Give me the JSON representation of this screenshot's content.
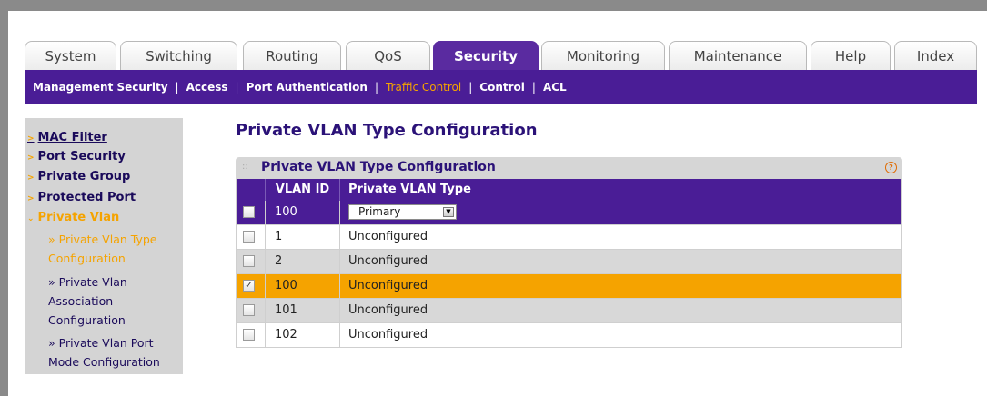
{
  "nav": {
    "tabs": [
      {
        "label": "System"
      },
      {
        "label": "Switching"
      },
      {
        "label": "Routing"
      },
      {
        "label": "QoS"
      },
      {
        "label": "Security",
        "active": true
      },
      {
        "label": "Monitoring"
      },
      {
        "label": "Maintenance"
      },
      {
        "label": "Help"
      },
      {
        "label": "Index"
      }
    ],
    "subnav": [
      {
        "label": "Management Security"
      },
      {
        "label": "Access"
      },
      {
        "label": "Port Authentication"
      },
      {
        "label": "Traffic Control",
        "active": true
      },
      {
        "label": "Control"
      },
      {
        "label": "ACL"
      }
    ]
  },
  "sidebar": {
    "items": [
      {
        "label": "MAC Filter"
      },
      {
        "label": "Port Security"
      },
      {
        "label": "Private Group"
      },
      {
        "label": "Protected Port"
      },
      {
        "label": "Private Vlan",
        "active": true
      }
    ],
    "subitems": [
      {
        "line1": "» Private Vlan Type",
        "line2": "Configuration",
        "active": true
      },
      {
        "line1": "» Private Vlan",
        "line2": "Association",
        "line3": "Configuration"
      },
      {
        "line1": "» Private Vlan Port",
        "line2": "Mode Configuration"
      }
    ]
  },
  "page": {
    "title": "Private VLAN Type Configuration",
    "box_title": "Private VLAN Type Configuration",
    "help_glyph": "?"
  },
  "table": {
    "headers": {
      "vlan_id": "VLAN ID",
      "type": "Private VLAN Type"
    },
    "edit_row": {
      "vlan_id": "100",
      "type": "Primary",
      "checked": false
    },
    "rows": [
      {
        "vlan_id": "1",
        "type": "Unconfigured",
        "checked": false
      },
      {
        "vlan_id": "2",
        "type": "Unconfigured",
        "checked": false
      },
      {
        "vlan_id": "100",
        "type": "Unconfigured",
        "checked": true
      },
      {
        "vlan_id": "101",
        "type": "Unconfigured",
        "checked": false
      },
      {
        "vlan_id": "102",
        "type": "Unconfigured",
        "checked": false
      }
    ]
  },
  "colors": {
    "brand_purple": "#4a1d96",
    "accent_orange": "#f5a300"
  }
}
